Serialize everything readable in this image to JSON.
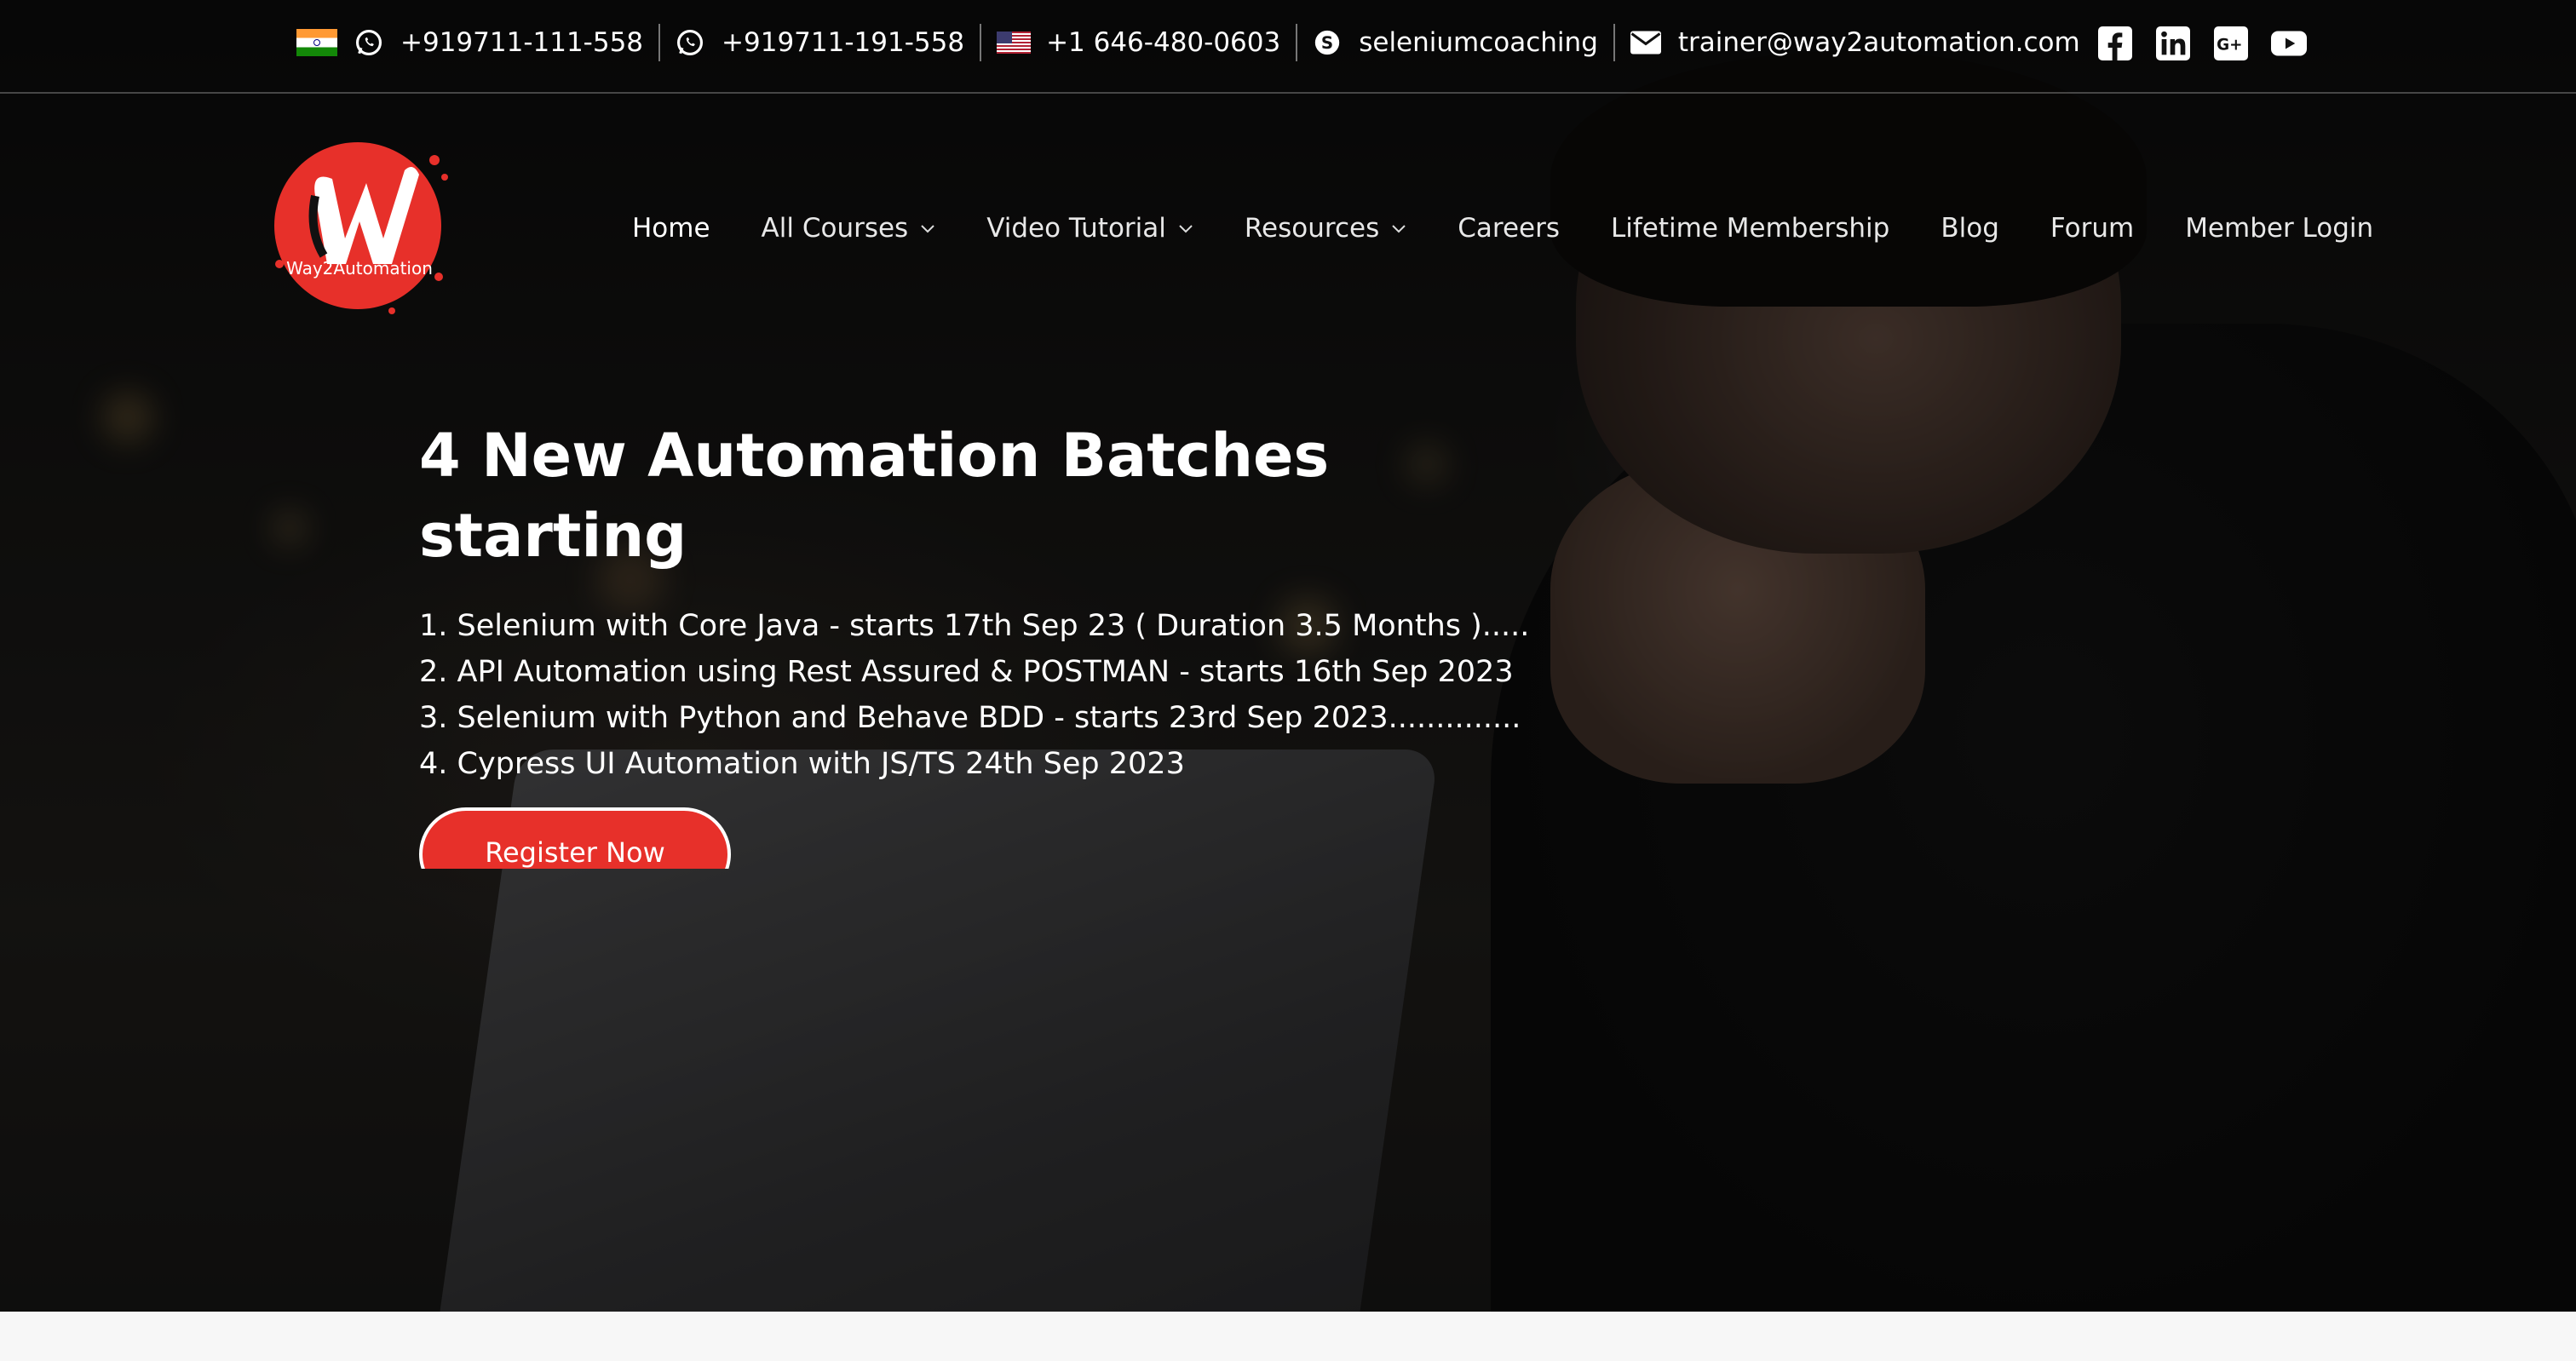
{
  "topbar": {
    "contacts": [
      {
        "icon": "whatsapp-icon",
        "flag": "india-flag-icon",
        "text": "+919711-111-558"
      },
      {
        "icon": "whatsapp-icon",
        "text": "+919711-191-558"
      },
      {
        "icon": "us-flag-icon",
        "text": "+1 646-480-0603"
      },
      {
        "icon": "skype-icon",
        "text": "seleniumcoaching"
      },
      {
        "icon": "envelope-icon",
        "text": "trainer@way2automation.com"
      }
    ],
    "social": [
      "facebook-icon",
      "linkedin-icon",
      "google-plus-icon",
      "youtube-icon"
    ]
  },
  "logo": {
    "text": "Way2Automation",
    "accent": "#e7302a"
  },
  "nav": {
    "items": [
      {
        "label": "Home",
        "active": true
      },
      {
        "label": "All Courses",
        "dropdown": true
      },
      {
        "label": "Video Tutorial",
        "dropdown": true
      },
      {
        "label": "Resources",
        "dropdown": true
      },
      {
        "label": "Careers"
      },
      {
        "label": "Lifetime Membership"
      },
      {
        "label": "Blog"
      },
      {
        "label": "Forum"
      },
      {
        "label": "Member Login"
      }
    ]
  },
  "hero": {
    "headline_line1": "4 New Automation Batches",
    "headline_line2": "starting",
    "batches": [
      "1. Selenium with Core Java - starts 17th Sep 23 ( Duration 3.5 Months ).....",
      "2. API Automation using Rest Assured & POSTMAN - starts 16th Sep 2023",
      "3. Selenium with Python and Behave BDD - starts 23rd Sep 2023..............",
      "4. Cypress UI Automation with JS/TS 24th Sep 2023"
    ],
    "cta": "Register Now"
  },
  "colors": {
    "accent": "#e7302a",
    "text": "#ffffff",
    "topbar_divider": "rgba(255,255,255,0.25)"
  }
}
